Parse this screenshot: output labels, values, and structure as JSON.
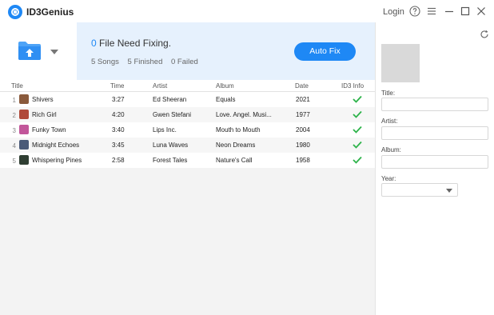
{
  "app": {
    "title": "ID3Genius",
    "login_label": "Login"
  },
  "header": {
    "need_fix_count": "0",
    "need_fix_text": "File Need Fixing.",
    "songs_stat": "5 Songs",
    "finished_stat": "5 Finished",
    "failed_stat": "0 Failed",
    "autofix_label": "Auto Fix"
  },
  "table": {
    "columns": [
      "Title",
      "Time",
      "Artist",
      "Album",
      "Date",
      "ID3 Info"
    ],
    "rows": [
      {
        "num": "1",
        "title": "Shivers",
        "time": "3:27",
        "artist": "Ed Sheeran",
        "album": "Equals",
        "date": "2021",
        "thumb_color": "#8a5a3c",
        "id3_ok": true
      },
      {
        "num": "2",
        "title": "Rich Girl",
        "time": "4:20",
        "artist": "Gwen Stefani",
        "album": "Love. Angel. Musi...",
        "date": "1977",
        "thumb_color": "#b04a3a",
        "id3_ok": true
      },
      {
        "num": "3",
        "title": "Funky Town",
        "time": "3:40",
        "artist": "Lips Inc.",
        "album": "Mouth to Mouth",
        "date": "2004",
        "thumb_color": "#c2569a",
        "id3_ok": true
      },
      {
        "num": "4",
        "title": "Midnight Echoes",
        "time": "3:45",
        "artist": "Luna Waves",
        "album": "Neon Dreams",
        "date": "1980",
        "thumb_color": "#4a5a78",
        "id3_ok": true
      },
      {
        "num": "5",
        "title": "Whispering Pines",
        "time": "2:58",
        "artist": "Forest Tales",
        "album": "Nature's Call",
        "date": "1958",
        "thumb_color": "#2f3e32",
        "id3_ok": true
      }
    ]
  },
  "side": {
    "title_label": "Title:",
    "artist_label": "Artist:",
    "album_label": "Album:",
    "year_label": "Year:",
    "title_value": "",
    "artist_value": "",
    "album_value": "",
    "year_value": ""
  },
  "colors": {
    "accent": "#1e88f5",
    "check": "#2db34a",
    "info_bg": "#e6f1fd"
  },
  "icons": [
    "logo-icon",
    "help-icon",
    "menu-icon",
    "minimize-icon",
    "maximize-icon",
    "close-icon",
    "folder-upload-icon",
    "chevron-down-icon",
    "check-icon",
    "refresh-icon"
  ]
}
